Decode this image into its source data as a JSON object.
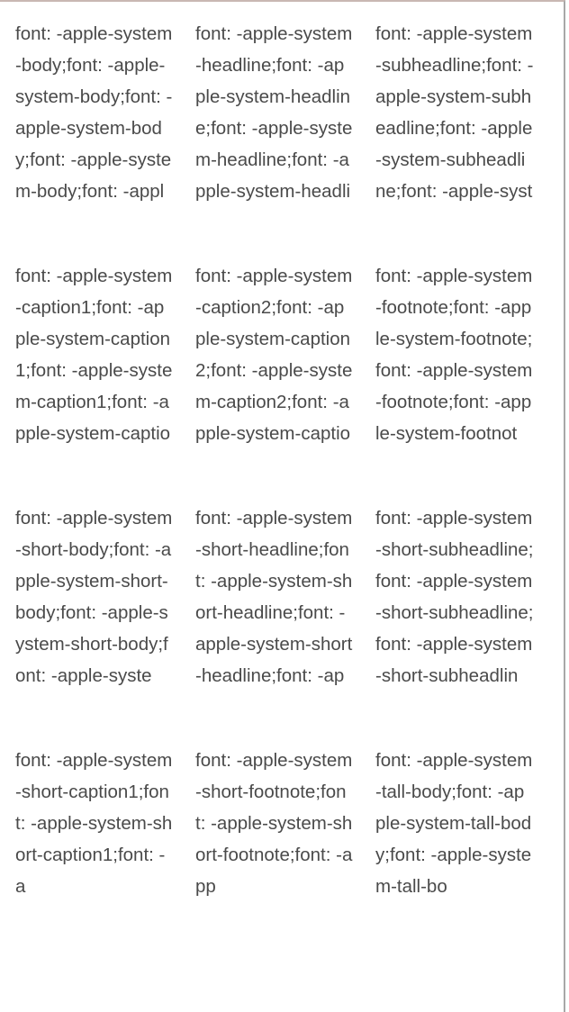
{
  "grid": {
    "rows": [
      {
        "cells": [
          {
            "text": "font: -apple-system-body;font: -apple-system-body;font: -apple-system-body;font: -apple-system-body;font: -apple-"
          },
          {
            "text": "font: -apple-system-headline;font: -apple-system-headline;font: -apple-system-headline;font: -apple-system-headli"
          },
          {
            "text": "font: -apple-system-subheadline;font: -apple-system-subheadline;font: -apple-system-subheadline;font: -apple-syst"
          }
        ]
      },
      {
        "cells": [
          {
            "text": "font: -apple-system-caption1;font: -apple-system-caption1;font: -apple-system-caption1;font: -apple-system-captio"
          },
          {
            "text": "font: -apple-system-caption2;font: -apple-system-caption2;font: -apple-system-caption2;font: -apple-system-captio"
          },
          {
            "text": "font: -apple-system-footnote;font: -apple-system-footnote;font: -apple-system-footnote;font: -apple-system-footnot"
          }
        ]
      },
      {
        "cells": [
          {
            "text": "font: -apple-system-short-body;font: -apple-system-short-body;font: -apple-system-short-body;font: -apple-syste"
          },
          {
            "text": "font: -apple-system-short-headline;font: -apple-system-short-headline;font: -apple-system-short-headline;font: -ap"
          },
          {
            "text": "font: -apple-system-short-subheadline;font: -apple-system-short-subheadline;font: -apple-system-short-subheadlin"
          }
        ]
      },
      {
        "cells": [
          {
            "text": "font: -apple-system-short-caption1;font: -apple-system-short-caption1;font: -a"
          },
          {
            "text": "font: -apple-system-short-footnote;font: -apple-system-short-footnote;font: -app"
          },
          {
            "text": "font: -apple-system-tall-body;font: -apple-system-tall-body;font: -apple-system-tall-bo"
          }
        ]
      }
    ]
  }
}
